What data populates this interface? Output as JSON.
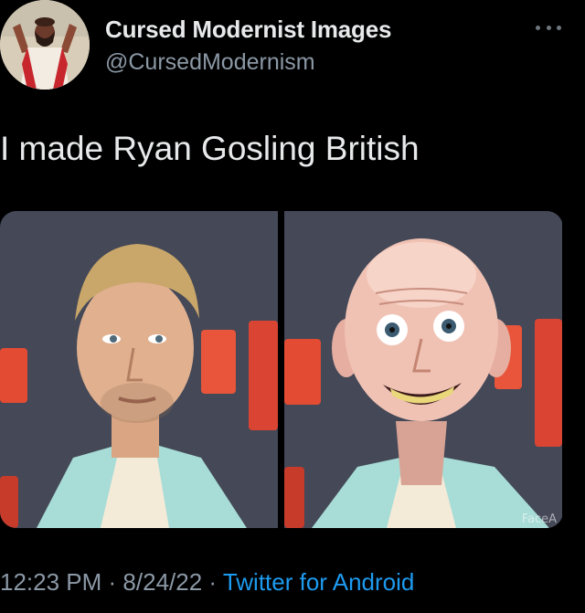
{
  "author": {
    "display_name": "Cursed Modernist Images",
    "handle": "@CursedModernism"
  },
  "tweet": {
    "text": "I made Ryan Gosling British"
  },
  "media": {
    "watermark": "FaceA"
  },
  "meta": {
    "time": "12:23 PM",
    "separator": "·",
    "date": "8/24/22",
    "source": "Twitter for Android"
  },
  "colors": {
    "background": "#000000",
    "text_primary": "#e7e9ea",
    "text_secondary": "#8b98a5",
    "link": "#1d9bf0"
  },
  "icons": {
    "more": "more-horizontal-icon"
  }
}
